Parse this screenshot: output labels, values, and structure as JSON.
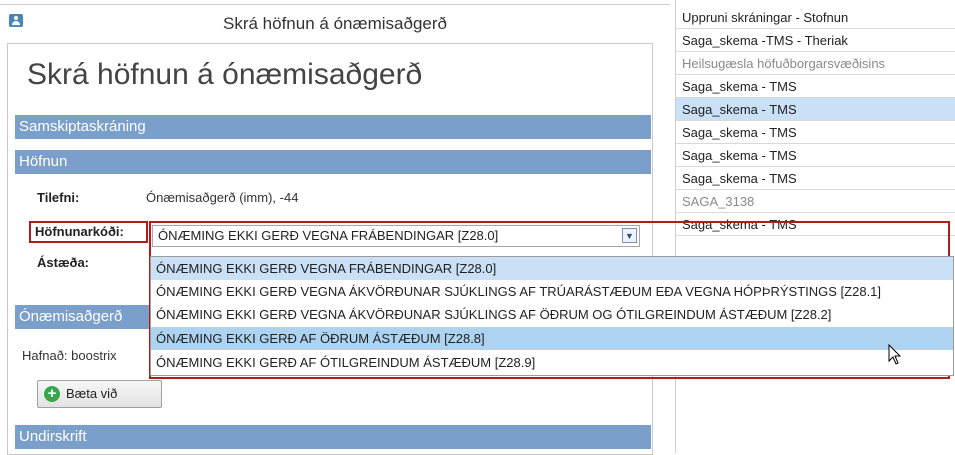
{
  "window": {
    "title": "Skrá höfnun á ónæmisaðgerð"
  },
  "page": {
    "heading": "Skrá höfnun á ónæmisaðgerð"
  },
  "sections": {
    "samskipti": "Samskiptaskráning",
    "hofnun": "Höfnun",
    "onaemis": "Ónæmisaðgerð",
    "undirskrift": "Undirskrift"
  },
  "form": {
    "tilefni_label": "Tilefni:",
    "tilefni_value": "Ónæmisaðgerð (imm), -44",
    "hofnunarkodi_label": "Höfnunarkóði:",
    "hofnunarkodi_selected": "ÓNÆMING EKKI GERÐ VEGNA FRÁBENDINGAR [Z28.0]",
    "astaeda_label": "Ástæða:"
  },
  "dropdown": {
    "options": [
      "ÓNÆMING EKKI GERÐ VEGNA FRÁBENDINGAR [Z28.0]",
      "ÓNÆMING EKKI GERÐ VEGNA ÁKVÖRÐUNAR SJÚKLINGS AF TRÚARÁSTÆÐUM EÐA VEGNA HÓPÞRÝSTINGS [Z28.1]",
      "ÓNÆMING EKKI GERÐ VEGNA ÁKVÖRÐUNAR SJÚKLINGS AF ÖÐRUM OG ÓTILGREINDUM ÁSTÆÐUM [Z28.2]",
      "ÓNÆMING EKKI GERÐ AF ÖÐRUM ÁSTÆÐUM [Z28.8]",
      "ÓNÆMING EKKI GERÐ AF ÓTILGREINDUM ÁSTÆÐUM [Z28.9]"
    ],
    "selected_index": 0,
    "hovered_index": 3
  },
  "onaemis": {
    "hafnad_text": "Hafnað: boostrix"
  },
  "buttons": {
    "add_label": "Bæta við"
  },
  "right_list": [
    "Uppruni skráningar - Stofnun",
    "Saga_skema -TMS - Theriak",
    "Heilsugæsla höfuðborgarsvæðisins",
    "Saga_skema - TMS",
    "Saga_skema - TMS",
    "Saga_skema - TMS",
    "Saga_skema - TMS",
    "Saga_skema - TMS",
    "SAGA_3138",
    "Saga_skema - TMS"
  ],
  "colors": {
    "section_header": "#7a9fcb",
    "highlight_box": "#b01c1c",
    "selected_row": "#c9e0f6"
  }
}
